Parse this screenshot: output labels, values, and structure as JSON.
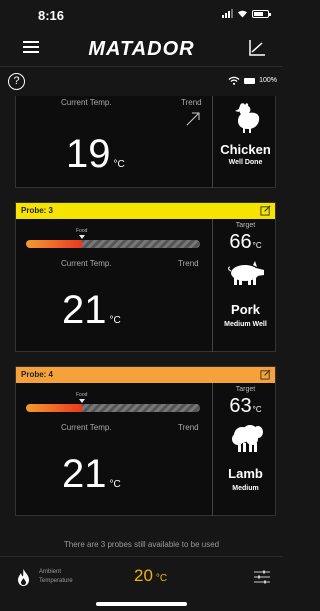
{
  "status_bar": {
    "time": "8:16"
  },
  "header": {
    "brand": "MATADOR"
  },
  "subheader": {
    "help": "?",
    "battery_pct": "100%"
  },
  "probes": [
    {
      "label": "",
      "current_label": "Current Temp.",
      "trend_label": "Trend",
      "current_temp": "19",
      "unit": "°C",
      "trend": "rising",
      "meat": "Chicken",
      "doneness": "Well Done"
    },
    {
      "label": "Probe: 3",
      "header_color": "#f5e400",
      "food_label": "Food",
      "progress": 0.32,
      "current_label": "Current Temp.",
      "trend_label": "Trend",
      "current_temp": "21",
      "unit": "°C",
      "target_label": "Target",
      "target_temp": "66",
      "meat": "Pork",
      "doneness": "Medium Well"
    },
    {
      "label": "Probe: 4",
      "header_color": "#f5a23a",
      "food_label": "Food",
      "progress": 0.32,
      "current_label": "Current Temp.",
      "trend_label": "Trend",
      "current_temp": "21",
      "unit": "°C",
      "target_label": "Target",
      "target_temp": "63",
      "meat": "Lamb",
      "doneness": "Medium"
    }
  ],
  "footer": {
    "message": "There are 3 probes still available to be used",
    "ambient_label_1": "Ambient",
    "ambient_label_2": "Temperature",
    "ambient_value": "20",
    "ambient_unit": "°C"
  },
  "colors": {
    "accent_ambient": "#f0b400",
    "bar_hot": "#e83a1e"
  },
  "icons": [
    "menu-icon",
    "chart-icon",
    "help-icon",
    "wifi-icon",
    "battery-icon",
    "edit-icon",
    "trend-arrow-icon",
    "chicken-icon",
    "pig-icon",
    "sheep-icon",
    "flame-icon",
    "settings-sliders-icon"
  ]
}
